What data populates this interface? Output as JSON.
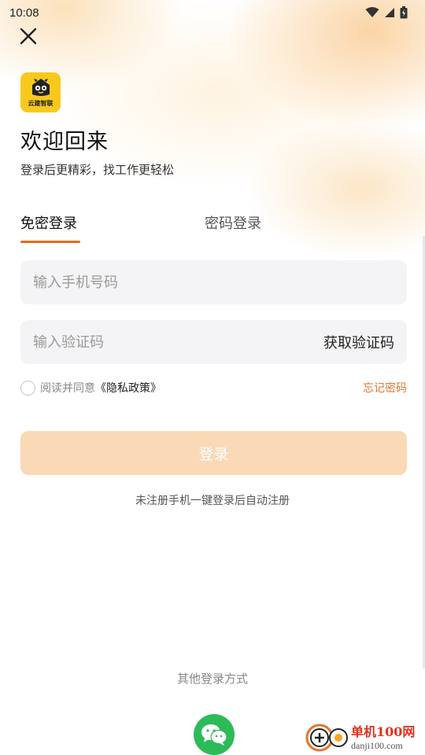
{
  "status_bar": {
    "time": "10:08",
    "icons": [
      "wifi-icon",
      "signal-icon",
      "battery-icon"
    ]
  },
  "header": {
    "close_icon": "close-icon",
    "logo_text": "云建智联",
    "title": "欢迎回来",
    "subtitle": "登录后更精彩，找工作更轻松"
  },
  "tabs": [
    {
      "label": "免密登录",
      "active": true
    },
    {
      "label": "密码登录",
      "active": false
    }
  ],
  "form": {
    "phone_placeholder": "输入手机号码",
    "code_placeholder": "输入验证码",
    "get_code_label": "获取验证码",
    "agree_prefix": "阅读并同意",
    "policy_label": "《隐私政策》",
    "forgot_label": "忘记密码",
    "login_label": "登录",
    "register_hint": "未注册手机一键登录后自动注册"
  },
  "other": {
    "label": "其他登录方式",
    "wechat_icon": "wechat-icon"
  },
  "watermark": {
    "cn": "单机100网",
    "en": "danji100.com"
  },
  "colors": {
    "accent": "#e86a1c",
    "forgot": "#e8742a",
    "login_button": "#fad9b6",
    "input_bg": "#f4f4f6",
    "wechat": "#2dbb5a",
    "logo_bg": "#f8c91d"
  }
}
